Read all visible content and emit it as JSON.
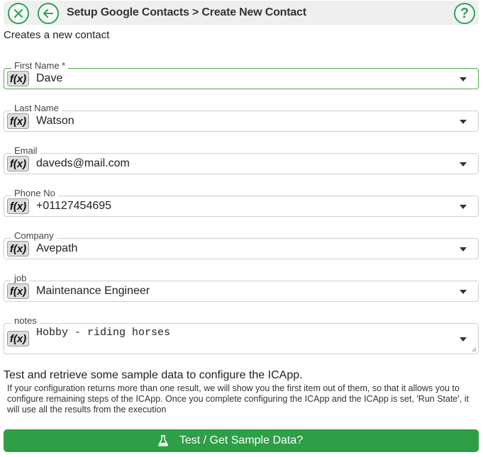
{
  "header": {
    "title": "Setup Google Contacts > Create New Contact",
    "close_icon": "close-circle-icon",
    "back_icon": "back-arrow-icon",
    "help_label": "?"
  },
  "subtitle": "Creates a new contact",
  "fx_label": "f(x)",
  "fields": [
    {
      "label": "First Name *",
      "value": "Dave"
    },
    {
      "label": "Last Name",
      "value": "Watson"
    },
    {
      "label": "Email",
      "value": "daveds@mail.com"
    },
    {
      "label": "Phone No",
      "value": "+01127454695"
    },
    {
      "label": "Company",
      "value": "Avepath"
    },
    {
      "label": "job",
      "value": "Maintenance Engineer"
    },
    {
      "label": "notes",
      "value": "Hobby - riding horses"
    }
  ],
  "info": {
    "title": "Test and retrieve some sample data to configure the ICApp.",
    "text": "If your configuration returns more than one result, we will show you the first item out of them, so that it allows you to configure remaining steps of the ICApp. Once you complete configuring the ICApp and the ICApp is set, 'Run State', it will use all the results from the execution"
  },
  "test_button": {
    "label": "Test / Get Sample Data?",
    "icon": "flask-icon"
  },
  "colors": {
    "accent": "#2aa35a",
    "button": "#2e9e47",
    "active_border": "#4caf50"
  }
}
